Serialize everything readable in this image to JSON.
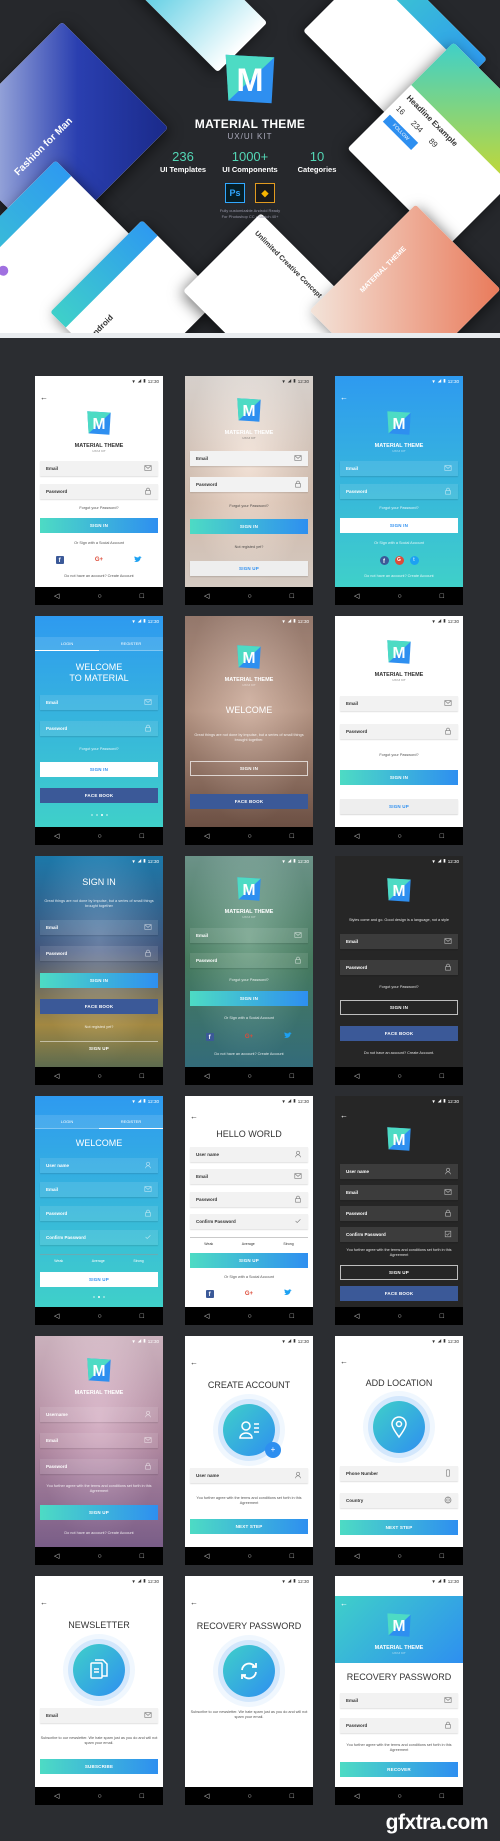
{
  "colors": {
    "accent_teal": "#4ddbc4",
    "accent_blue": "#2e8ff0",
    "facebook": "#3b5998",
    "google": "#dd4b39",
    "twitter": "#1da1f2",
    "hero_bg": "#26282c",
    "grid_bg": "#2b2d31",
    "dark_screen": "#262626"
  },
  "hero": {
    "title": "MATERIAL THEME",
    "subtitle": "UX/UI KIT",
    "stats": [
      {
        "value": "236",
        "label": "UI Templates"
      },
      {
        "value": "1000+",
        "label": "UI Components"
      },
      {
        "value": "10",
        "label": "Categories"
      }
    ],
    "tools": [
      {
        "name": "Ps",
        "icon": "photoshop-icon"
      },
      {
        "name": "Sketch",
        "icon": "sketch-icon"
      }
    ],
    "fine_print": [
      "Fully customizable Android Ready",
      "For Photoshop CC • Sketch 40+"
    ],
    "mockups": {
      "fashion": "Fashion for Man",
      "headline": "Headline Example",
      "stats": [
        "16",
        "234",
        "89"
      ],
      "concept": "Unlimited Creative Concept",
      "android": "Android",
      "follow": "FOLLOW",
      "brand": "MATERIAL THEME"
    }
  },
  "status_time": "12:30",
  "watermark": "gfxtra.com",
  "screens": [
    {
      "bg": "#ffffff",
      "theme": "light",
      "items": [
        {
          "t": "back"
        },
        {
          "t": "logo",
          "label": "MATERIAL THEME",
          "sub": "UX/UI KIT"
        },
        {
          "t": "field",
          "label": "Email",
          "icon": "mail"
        },
        {
          "t": "field",
          "label": "Password",
          "icon": "lock"
        },
        {
          "t": "link",
          "label": "Forgot your Password?"
        },
        {
          "t": "button",
          "v": "grad",
          "label": "SIGN IN"
        },
        {
          "t": "text",
          "label": "Or Sign with a Social Account"
        },
        {
          "t": "social"
        },
        {
          "t": "text",
          "label": "Do not have an account? Create Account"
        }
      ]
    },
    {
      "bg": "linear-gradient(180deg,#f3ece7,#ecd3c2 60%,#f2e6dd)",
      "photo": "legs",
      "theme": "light",
      "items": [
        {
          "t": "logo",
          "label": "MATERIAL THEME",
          "sub": "UX/UI KIT",
          "light": true
        },
        {
          "t": "field",
          "label": "Email",
          "icon": "mail"
        },
        {
          "t": "field",
          "label": "Password",
          "icon": "lock"
        },
        {
          "t": "link",
          "label": "Forgot your Password?"
        },
        {
          "t": "button",
          "v": "grad",
          "label": "SIGN IN"
        },
        {
          "t": "text",
          "label": "Not registed yet?"
        },
        {
          "t": "button",
          "v": "light",
          "label": "SIGN UP"
        }
      ]
    },
    {
      "bg": "linear-gradient(180deg,#2e9af0,#3fd0c9)",
      "theme": "dark",
      "items": [
        {
          "t": "back"
        },
        {
          "t": "logo",
          "label": "MATERIAL THEME",
          "sub": "UX/UI KIT"
        },
        {
          "t": "field",
          "label": "Email",
          "icon": "mail"
        },
        {
          "t": "field",
          "label": "Password",
          "icon": "lock"
        },
        {
          "t": "link",
          "label": "Forgot your Password?"
        },
        {
          "t": "button",
          "v": "white",
          "label": "SIGN IN"
        },
        {
          "t": "text",
          "label": "Or Sign with a Social Account"
        },
        {
          "t": "social",
          "round": true
        },
        {
          "t": "text",
          "label": "Do not have an account? Create Account"
        }
      ]
    },
    {
      "bg": "linear-gradient(180deg,#2e9af0,#3fd0c9)",
      "theme": "dark",
      "items": [
        {
          "t": "tabs",
          "tabs": [
            "LOGIN",
            "REGISTER"
          ],
          "active": 0
        },
        {
          "t": "heading",
          "label": "WELCOME\nTO MATERIAL"
        },
        {
          "t": "field",
          "label": "Email",
          "icon": "mail"
        },
        {
          "t": "field",
          "label": "Password",
          "icon": "lock"
        },
        {
          "t": "link",
          "label": "Forgot your Password?"
        },
        {
          "t": "button",
          "v": "white",
          "label": "SIGN IN"
        },
        {
          "t": "button",
          "v": "fb",
          "label": "FACE BOOK"
        },
        {
          "t": "dots",
          "count": 4,
          "active": 2
        }
      ]
    },
    {
      "bg": "linear-gradient(180deg,#a8887a,#c9a592 45%,#7a5a4c)",
      "photo": "face",
      "theme": "dark",
      "items": [
        {
          "t": "logo",
          "label": "MATERIAL THEME",
          "sub": "UX/UI KIT"
        },
        {
          "t": "heading",
          "label": "WELCOME"
        },
        {
          "t": "text",
          "label": "Great things are not done by impulse, but a series of small things brought together."
        },
        {
          "t": "button",
          "v": "outline",
          "label": "SIGN IN"
        },
        {
          "t": "button",
          "v": "fb",
          "label": "FACE BOOK"
        }
      ]
    },
    {
      "bg": "#ffffff",
      "theme": "light",
      "items": [
        {
          "t": "logo",
          "label": "MATERIAL THEME",
          "sub": "UX/UI KIT"
        },
        {
          "t": "field",
          "label": "Email",
          "icon": "mail"
        },
        {
          "t": "field",
          "label": "Password",
          "icon": "lock"
        },
        {
          "t": "link",
          "label": "Forgot your Password?"
        },
        {
          "t": "button",
          "v": "grad",
          "label": "SIGN IN"
        },
        {
          "t": "button",
          "v": "light",
          "label": "SIGN UP"
        }
      ]
    },
    {
      "bg": "linear-gradient(180deg,#1f88c0,#4a5f8a 45%,#b89a4a 80%,#6a7a5a)",
      "photo": "woman",
      "theme": "dark",
      "items": [
        {
          "t": "heading",
          "label": "SIGN IN"
        },
        {
          "t": "text",
          "label": "Great things are not done by impulse, but a series of small things brought together"
        },
        {
          "t": "field",
          "label": "Email",
          "icon": "mail"
        },
        {
          "t": "field",
          "label": "Password",
          "icon": "lock"
        },
        {
          "t": "button",
          "v": "grad",
          "label": "SIGN IN"
        },
        {
          "t": "button",
          "v": "fb",
          "label": "FACE BOOK"
        },
        {
          "t": "text",
          "label": "Not registed yet?"
        },
        {
          "t": "button",
          "v": "ghost",
          "label": "SIGN UP"
        }
      ]
    },
    {
      "bg": "linear-gradient(180deg,#7aa69a,#4f8a6a 50%,#3a7a8a)",
      "photo": "girl",
      "theme": "dark",
      "items": [
        {
          "t": "logo",
          "label": "MATERIAL THEME",
          "sub": "UX/UI KIT"
        },
        {
          "t": "field",
          "label": "Email",
          "icon": "mail"
        },
        {
          "t": "field",
          "label": "Password",
          "icon": "lock"
        },
        {
          "t": "link",
          "label": "Forgot your Password?"
        },
        {
          "t": "button",
          "v": "grad",
          "label": "SIGN IN"
        },
        {
          "t": "text",
          "label": "Or Sign with a Social Account"
        },
        {
          "t": "social"
        },
        {
          "t": "text",
          "label": "Do not have an account? Create Account"
        }
      ]
    },
    {
      "bg": "#262626",
      "theme": "dark",
      "items": [
        {
          "t": "logo"
        },
        {
          "t": "text",
          "label": "Styles come and go. Good design is a language, not a style"
        },
        {
          "t": "field",
          "label": "Email",
          "icon": "mail"
        },
        {
          "t": "field",
          "label": "Password",
          "icon": "lock"
        },
        {
          "t": "link",
          "label": "Forgot your Password?"
        },
        {
          "t": "button",
          "v": "outline",
          "label": "SIGN IN"
        },
        {
          "t": "button",
          "v": "fb",
          "label": "FACE BOOK"
        },
        {
          "t": "text",
          "label": "Do not have an account? Create Account."
        }
      ]
    },
    {
      "bg": "linear-gradient(180deg,#2e9af0,#3fd0c9)",
      "theme": "dark",
      "items": [
        {
          "t": "tabs",
          "tabs": [
            "LOGIN",
            "REGISTER"
          ],
          "active": 1
        },
        {
          "t": "heading",
          "label": "WELCOME"
        },
        {
          "t": "field",
          "label": "User name",
          "icon": "user"
        },
        {
          "t": "field",
          "label": "Email",
          "icon": "mail"
        },
        {
          "t": "field",
          "label": "Password",
          "icon": "lock"
        },
        {
          "t": "field",
          "label": "Confirm Password",
          "icon": "check"
        },
        {
          "t": "strength",
          "labels": [
            "Weak",
            "Average",
            "Strong"
          ]
        },
        {
          "t": "button",
          "v": "white",
          "label": "SIGN UP"
        },
        {
          "t": "dots",
          "count": 3,
          "active": 1
        }
      ]
    },
    {
      "bg": "#ffffff",
      "theme": "light",
      "items": [
        {
          "t": "back"
        },
        {
          "t": "heading",
          "label": "HELLO WORLD"
        },
        {
          "t": "field",
          "label": "User name",
          "icon": "user"
        },
        {
          "t": "field",
          "label": "Email",
          "icon": "mail"
        },
        {
          "t": "field",
          "label": "Password",
          "icon": "lock"
        },
        {
          "t": "field",
          "label": "Confirm Password",
          "icon": "check"
        },
        {
          "t": "strength",
          "labels": [
            "Weak",
            "Average",
            "Strong"
          ]
        },
        {
          "t": "button",
          "v": "grad",
          "label": "SIGN UP"
        },
        {
          "t": "text",
          "label": "Or Sign with a Social Account"
        },
        {
          "t": "social"
        }
      ]
    },
    {
      "bg": "#262626",
      "theme": "dark",
      "items": [
        {
          "t": "back"
        },
        {
          "t": "logo"
        },
        {
          "t": "field",
          "label": "User name",
          "icon": "user"
        },
        {
          "t": "field",
          "label": "Email",
          "icon": "mail"
        },
        {
          "t": "field",
          "label": "Password",
          "icon": "lock"
        },
        {
          "t": "field",
          "label": "Confirm Password",
          "icon": "checkbox"
        },
        {
          "t": "text",
          "label": "You further agree with the terms and conditions set forth in this Agreement"
        },
        {
          "t": "button",
          "v": "outline",
          "label": "SIGN UP"
        },
        {
          "t": "button",
          "v": "fb",
          "label": "FACE BOOK"
        }
      ]
    },
    {
      "bg": "linear-gradient(180deg,#e6c9d6,#c89ab4 50%,#8a6a9a)",
      "photo": "pink",
      "theme": "dark",
      "items": [
        {
          "t": "logo",
          "label": "MATERIAL THEME"
        },
        {
          "t": "field",
          "label": "Username",
          "icon": "user"
        },
        {
          "t": "field",
          "label": "Email",
          "icon": "mail"
        },
        {
          "t": "field",
          "label": "Password",
          "icon": "lock"
        },
        {
          "t": "text",
          "label": "You further agree with the terms and conditions set forth in this Agreement"
        },
        {
          "t": "button",
          "v": "grad",
          "label": "SIGN UP"
        },
        {
          "t": "text",
          "label": "Do not have an account? Create Account"
        }
      ]
    },
    {
      "bg": "#ffffff",
      "theme": "light",
      "items": [
        {
          "t": "back"
        },
        {
          "t": "heading",
          "label": "CREATE ACCOUNT"
        },
        {
          "t": "circle",
          "icon": "user-card",
          "plus": true
        },
        {
          "t": "field",
          "label": "User name",
          "icon": "user"
        },
        {
          "t": "text",
          "label": "You further agree with the terms and conditions set forth in this Agreement"
        },
        {
          "t": "button",
          "v": "grad",
          "label": "NEXT STEP"
        }
      ]
    },
    {
      "bg": "#ffffff",
      "theme": "light",
      "items": [
        {
          "t": "back"
        },
        {
          "t": "heading",
          "label": "ADD LOCATION"
        },
        {
          "t": "circle",
          "icon": "location-pin"
        },
        {
          "t": "field",
          "label": "Phone Number",
          "icon": "phone"
        },
        {
          "t": "field",
          "label": "Country",
          "icon": "globe"
        },
        {
          "t": "button",
          "v": "grad",
          "label": "NEXT STEP"
        }
      ]
    },
    {
      "bg": "#ffffff",
      "theme": "light",
      "items": [
        {
          "t": "back"
        },
        {
          "t": "heading",
          "label": "NEWSLETTER"
        },
        {
          "t": "circle",
          "icon": "documents"
        },
        {
          "t": "field",
          "label": "Email",
          "icon": "mail"
        },
        {
          "t": "text",
          "label": "Subscribe to our newsletter. We hate spam just as you do and will not spam your email."
        },
        {
          "t": "button",
          "v": "grad",
          "label": "SUBSCRIBE"
        }
      ]
    },
    {
      "bg": "#ffffff",
      "theme": "light",
      "items": [
        {
          "t": "back"
        },
        {
          "t": "heading",
          "label": "RECOVERY PASSWORD"
        },
        {
          "t": "circle",
          "icon": "refresh"
        },
        {
          "t": "text",
          "label": "Subscribe to our newsletter. We hate spam just as you do and will not spam your email."
        },
        {
          "t": "spacer"
        }
      ]
    },
    {
      "bg": "#ffffff",
      "theme": "light",
      "items": [
        {
          "t": "gradheader",
          "label": "MATERIAL THEME",
          "sub": "UX/UI KIT"
        },
        {
          "t": "heading",
          "label": "RECOVERY PASSWORD"
        },
        {
          "t": "field",
          "label": "Email",
          "icon": "mail"
        },
        {
          "t": "field",
          "label": "Password",
          "icon": "lock"
        },
        {
          "t": "text",
          "label": "You further agree with the terms and conditions set forth in this Agreement"
        },
        {
          "t": "button",
          "v": "grad",
          "label": "RECOVER"
        }
      ]
    }
  ]
}
